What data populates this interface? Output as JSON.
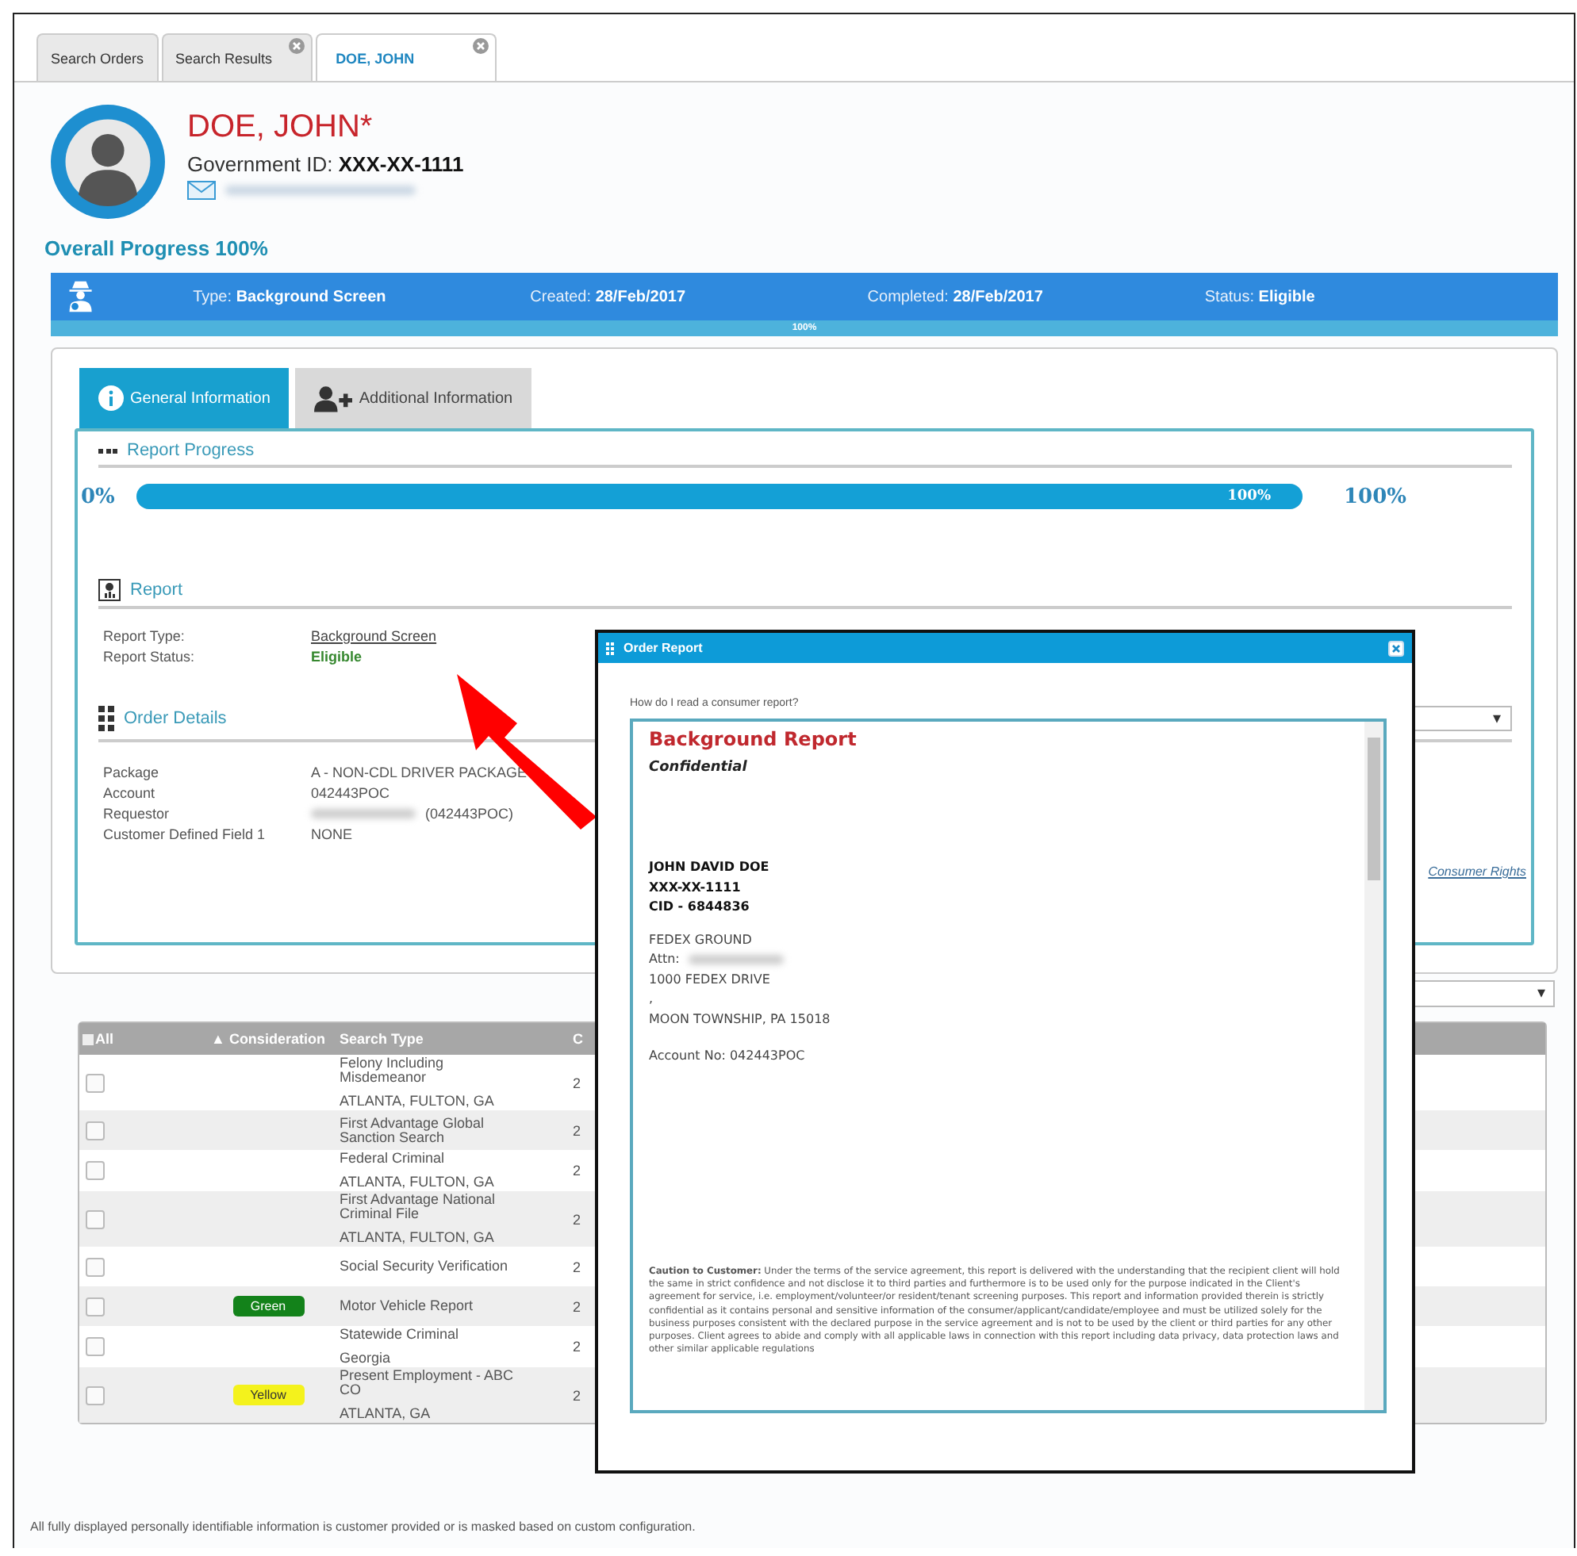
{
  "tabs": [
    {
      "label": "Search Orders",
      "closable": false,
      "selected": false
    },
    {
      "label": "Search Results",
      "closable": true,
      "selected": false
    },
    {
      "label": "DOE, JOHN",
      "closable": true,
      "selected": true
    }
  ],
  "profile": {
    "name": "DOE, JOHN*",
    "gov_id_label": "Government ID:",
    "gov_id": "XXX-XX-1111"
  },
  "overall_progress": "Overall Progress 100%",
  "summary_bar": {
    "fields": [
      {
        "label": "Type:",
        "value": "Background Screen"
      },
      {
        "label": "Created:",
        "value": "28/Feb/2017"
      },
      {
        "label": "Completed:",
        "value": "28/Feb/2017"
      },
      {
        "label": "Status:",
        "value": "Eligible"
      }
    ],
    "progress_label": "100%",
    "level": 1
  },
  "detail_tabs": [
    {
      "label": "General Information",
      "kind": "info",
      "selected": true
    },
    {
      "label": "Additional Information",
      "kind": "add-user",
      "selected": false
    }
  ],
  "report_progress": {
    "title": "Report Progress",
    "start": "0%",
    "bar_label": "100%",
    "level": 1,
    "end": "100%"
  },
  "report": {
    "title": "Report",
    "fields": [
      {
        "label": "Report Type:",
        "value": "Background Screen",
        "kind": "link"
      },
      {
        "label": "Report Status:",
        "value": "Eligible",
        "kind": "status"
      }
    ]
  },
  "order_details": {
    "title": "Order Details",
    "dropdown_caret": "▾",
    "fields": [
      {
        "label": "Package",
        "value": "A - NON-CDL DRIVER PACKAGE",
        "kind": "text"
      },
      {
        "label": "Account",
        "value": "042443POC",
        "kind": "text"
      },
      {
        "label": "Requestor",
        "value": "(042443POC)",
        "kind": "masked"
      },
      {
        "label": "Customer Defined Field 1",
        "value": "NONE",
        "kind": "text"
      }
    ],
    "rights_link": "Consumer Rights"
  },
  "table_filter_caret": "▾",
  "table": {
    "all_checked": false,
    "columns": [
      "All",
      "▲ Consideration",
      "Search Type",
      "C"
    ],
    "rows": [
      {
        "checked": false,
        "consideration": null,
        "search_type": "Felony Including Misdemeanor",
        "location": "ATLANTA, FULTON, GA",
        "column_4": "2"
      },
      {
        "checked": false,
        "consideration": null,
        "search_type": "First Advantage Global Sanction Search",
        "location": null,
        "column_4": "2"
      },
      {
        "checked": false,
        "consideration": null,
        "search_type": "Federal Criminal",
        "location": "ATLANTA, FULTON, GA",
        "column_4": "2"
      },
      {
        "checked": false,
        "consideration": null,
        "search_type": "First Advantage National Criminal File",
        "location": "ATLANTA, FULTON, GA",
        "column_4": "2"
      },
      {
        "checked": false,
        "consideration": null,
        "search_type": "Social Security Verification",
        "location": null,
        "column_4": "2"
      },
      {
        "checked": false,
        "consideration": {
          "label": "Green",
          "color": "#13821a"
        },
        "search_type": "Motor Vehicle Report",
        "location": null,
        "column_4": "2"
      },
      {
        "checked": false,
        "consideration": null,
        "search_type": "Statewide Criminal",
        "location": "Georgia",
        "column_4": "2"
      },
      {
        "checked": false,
        "consideration": {
          "label": "Yellow",
          "color": "#f4f21c"
        },
        "search_type": "Present Employment - ABC CO",
        "location": "ATLANTA, GA",
        "column_4": "2"
      }
    ]
  },
  "footer": "All fully displayed personally identifiable information is customer provided or is masked based on custom configuration.",
  "modal": {
    "title": "Order Report",
    "help": "How do I read a consumer report?",
    "report_title": "Background Report",
    "subtitle": "Confidential",
    "subject_lines": [
      "JOHN DAVID DOE",
      "XXX-XX-1111",
      "CID - 6844836"
    ],
    "address_lines": [
      {
        "text": "FEDEX GROUND",
        "kind": "text"
      },
      {
        "text": "Attn:",
        "kind": "masked"
      },
      {
        "text": "1000 FEDEX DRIVE",
        "kind": "text"
      },
      {
        "text": ",",
        "kind": "text"
      },
      {
        "text": "MOON TOWNSHIP, PA 15018",
        "kind": "text"
      }
    ],
    "account": "Account No: 042443POC",
    "caution": "**Caution to Customer:** Under the terms of the service agreement, this report is delivered with the understanding that the recipient client will hold the same in strict confidence and not disclose it to third parties and furthermore is to be used only for the purpose indicated in the Client's agreement for service, i.e. employment/volunteer/or resident/tenant screening purposes. This report and information provided therein is strictly confidential as it contains personal and sensitive information of the consumer/applicant/candidate/employee and must be utilized solely for the business purposes consistent with the declared purpose in the service agreement and is not to be used by the client or third parties for any other purposes. Client agrees to abide and comply with all applicable laws in connection with this report including data privacy, data protection laws and other similar applicable regulations"
  }
}
